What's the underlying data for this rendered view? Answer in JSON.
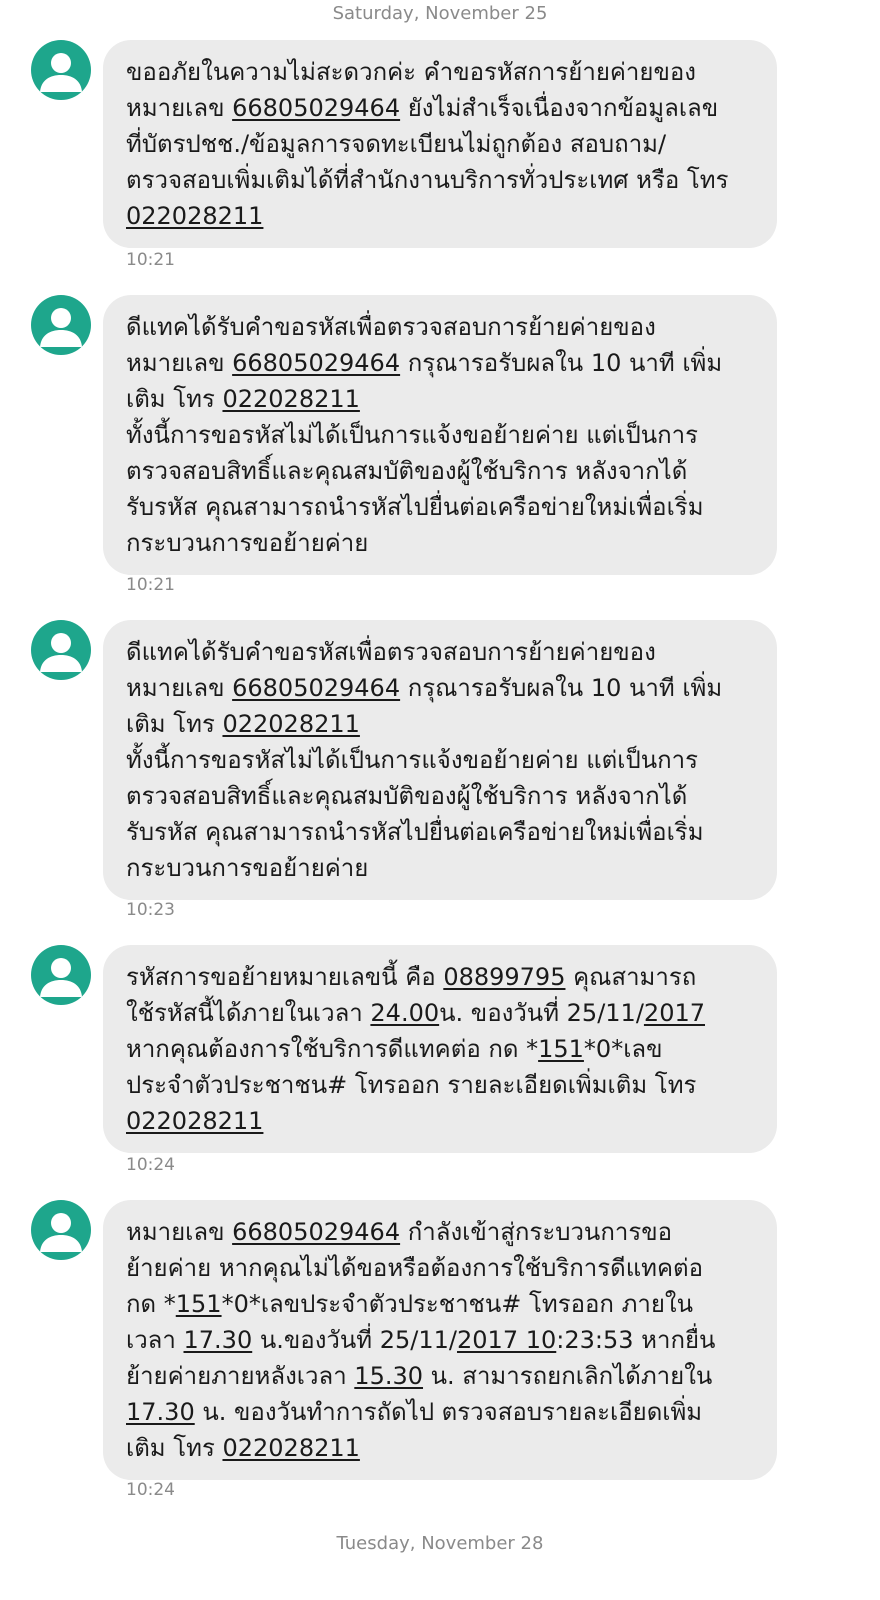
{
  "date_separators": [
    "Saturday, November 25",
    "Tuesday, November 28"
  ],
  "colors": {
    "avatar": "#1ea68c",
    "bubble": "#ebebeb",
    "meta_text": "#8a8a8a"
  },
  "messages": [
    {
      "time": "10:21",
      "lines": [
        [
          {
            "t": "ขออภัยในความไม่สะดวกค่ะ คำขอรหัสการย้ายค่ายของ"
          }
        ],
        [
          {
            "t": "หมายเลข "
          },
          {
            "t": "66805029464",
            "u": true
          },
          {
            "t": " ยังไม่สำเร็จเนื่องจากข้อมูลเลข"
          }
        ],
        [
          {
            "t": "ที่บัตรปชช./ข้อมูลการจดทะเบียนไม่ถูกต้อง สอบถาม/"
          }
        ],
        [
          {
            "t": "ตรวจสอบเพิ่มเติมได้ที่สำนักงานบริการทั่วประเทศ หรือ โทร"
          }
        ],
        [
          {
            "t": "022028211",
            "u": true
          }
        ]
      ]
    },
    {
      "time": "10:21",
      "lines": [
        [
          {
            "t": "ดีแทคได้รับคำขอรหัสเพื่อตรวจสอบการย้ายค่ายของ"
          }
        ],
        [
          {
            "t": "หมายเลข "
          },
          {
            "t": "66805029464",
            "u": true
          },
          {
            "t": " กรุณารอรับผลใน 10 นาที เพิ่ม"
          }
        ],
        [
          {
            "t": "เติม โทร "
          },
          {
            "t": "022028211",
            "u": true
          }
        ],
        [
          {
            "t": "ทั้งนี้การขอรหัสไม่ได้เป็นการแจ้งขอย้ายค่าย แต่เป็นการ"
          }
        ],
        [
          {
            "t": "ตรวจสอบสิทธิ์และคุณสมบัติของผู้ใช้บริการ หลังจากได้"
          }
        ],
        [
          {
            "t": "รับรหัส คุณสามารถนำรหัสไปยื่นต่อเครือข่ายใหม่เพื่อเริ่ม"
          }
        ],
        [
          {
            "t": "กระบวนการขอย้ายค่าย"
          }
        ]
      ]
    },
    {
      "time": "10:23",
      "lines": [
        [
          {
            "t": "ดีแทคได้รับคำขอรหัสเพื่อตรวจสอบการย้ายค่ายของ"
          }
        ],
        [
          {
            "t": "หมายเลข "
          },
          {
            "t": "66805029464",
            "u": true
          },
          {
            "t": " กรุณารอรับผลใน 10 นาที เพิ่ม"
          }
        ],
        [
          {
            "t": "เติม โทร "
          },
          {
            "t": "022028211",
            "u": true
          }
        ],
        [
          {
            "t": "ทั้งนี้การขอรหัสไม่ได้เป็นการแจ้งขอย้ายค่าย แต่เป็นการ"
          }
        ],
        [
          {
            "t": "ตรวจสอบสิทธิ์และคุณสมบัติของผู้ใช้บริการ หลังจากได้"
          }
        ],
        [
          {
            "t": "รับรหัส คุณสามารถนำรหัสไปยื่นต่อเครือข่ายใหม่เพื่อเริ่ม"
          }
        ],
        [
          {
            "t": "กระบวนการขอย้ายค่าย"
          }
        ]
      ]
    },
    {
      "time": "10:24",
      "lines": [
        [
          {
            "t": "รหัสการขอย้ายหมายเลขนี้ คือ "
          },
          {
            "t": "08899795",
            "u": true
          },
          {
            "t": " คุณสามารถ"
          }
        ],
        [
          {
            "t": "ใช้รหัสนี้ได้ภายในเวลา "
          },
          {
            "t": "24.00",
            "u": true
          },
          {
            "t": "น. ของวันที่ 25/11/"
          },
          {
            "t": "2017",
            "u": true
          }
        ],
        [
          {
            "t": "หากคุณต้องการใช้บริการดีแทคต่อ กด *"
          },
          {
            "t": "151",
            "u": true
          },
          {
            "t": "*0*เลข"
          }
        ],
        [
          {
            "t": "ประจำตัวประชาชน# โทรออก  รายละเอียดเพิ่มเติม โทร"
          }
        ],
        [
          {
            "t": "022028211",
            "u": true
          }
        ]
      ]
    },
    {
      "time": "10:24",
      "lines": [
        [
          {
            "t": "หมายเลข "
          },
          {
            "t": "66805029464",
            "u": true
          },
          {
            "t": " กำลังเข้าสู่กระบวนการขอ"
          }
        ],
        [
          {
            "t": "ย้ายค่าย หากคุณไม่ได้ขอหรือต้องการใช้บริการดีแทคต่อ"
          }
        ],
        [
          {
            "t": "กด *"
          },
          {
            "t": "151",
            "u": true
          },
          {
            "t": "*0*เลขประจำตัวประชาชน# โทรออก  ภายใน"
          }
        ],
        [
          {
            "t": "เวลา "
          },
          {
            "t": "17.30",
            "u": true
          },
          {
            "t": " น.ของวันที่ 25/11/"
          },
          {
            "t": "2017 10",
            "u": true
          },
          {
            "t": ":23:53 หากยื่น"
          }
        ],
        [
          {
            "t": "ย้ายค่ายภายหลังเวลา "
          },
          {
            "t": "15.30",
            "u": true
          },
          {
            "t": " น. สามารถยกเลิกได้ภายใน"
          }
        ],
        [
          {
            "t": "17.30",
            "u": true
          },
          {
            "t": " น. ของวันทำการถัดไป ตรวจสอบรายละเอียดเพิ่ม"
          }
        ],
        [
          {
            "t": "เติม โทร "
          },
          {
            "t": "022028211",
            "u": true
          }
        ]
      ]
    }
  ]
}
